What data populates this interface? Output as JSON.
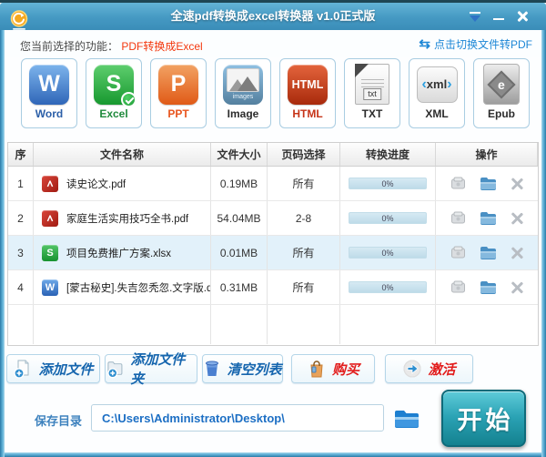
{
  "window": {
    "title": "全速pdf转换成excel转换器 v1.0正式版"
  },
  "function_bar": {
    "label": "您当前选择的功能：",
    "current": "PDF转换成Excel",
    "switch_icon": "⇆",
    "switch_link": "点击切换文件转PDF"
  },
  "formats": [
    {
      "label": "Word",
      "icon_text": "W"
    },
    {
      "label": "Excel",
      "icon_text": "S",
      "selected": true
    },
    {
      "label": "PPT",
      "icon_text": "P"
    },
    {
      "label": "Image",
      "icon_caption": "images"
    },
    {
      "label": "HTML",
      "icon_text": "HTML"
    },
    {
      "label": "TXT",
      "icon_text": "txt"
    },
    {
      "label": "XML",
      "icon_text": "xml"
    },
    {
      "label": "Epub",
      "icon_text": "e"
    }
  ],
  "table": {
    "headers": [
      "序",
      "文件名称",
      "文件大小",
      "页码选择",
      "转换进度",
      "操作"
    ],
    "rows": [
      {
        "index": "1",
        "type": "pdf",
        "name": "读史论文.pdf",
        "size": "0.19MB",
        "pages": "所有",
        "progress": "0%"
      },
      {
        "index": "2",
        "type": "pdf",
        "name": "家庭生活实用技巧全书.pdf",
        "size": "54.04MB",
        "pages": "2-8",
        "progress": "0%"
      },
      {
        "index": "3",
        "type": "xlsx",
        "name": "项目免费推广方案.xlsx",
        "size": "0.01MB",
        "pages": "所有",
        "progress": "0%",
        "highlighted": true
      },
      {
        "index": "4",
        "type": "doc",
        "name": "[蒙古秘史].失吉忽秃忽.文字版.doc",
        "size": "0.31MB",
        "pages": "所有",
        "progress": "0%"
      }
    ]
  },
  "toolbar": {
    "add_file": "添加文件",
    "add_folder": "添加文件夹",
    "clear_list": "清空列表",
    "buy": "购买",
    "activate": "激活"
  },
  "footer": {
    "save_dir_label": "保存目录",
    "save_path": "C:\\Users\\Administrator\\Desktop\\",
    "start_label": "开始"
  },
  "colors": {
    "titlebar": "#4599c3",
    "frame": "#2c7ba8",
    "function_red": "#f3380e",
    "link_blue": "#1d87d6",
    "row_highlight": "#e2f1fa",
    "progress_track": "#c6e0ec",
    "start_button": "#1f97a9",
    "toolbar_text_blue": "#1565ae",
    "toolbar_text_red": "#e21b1b"
  }
}
